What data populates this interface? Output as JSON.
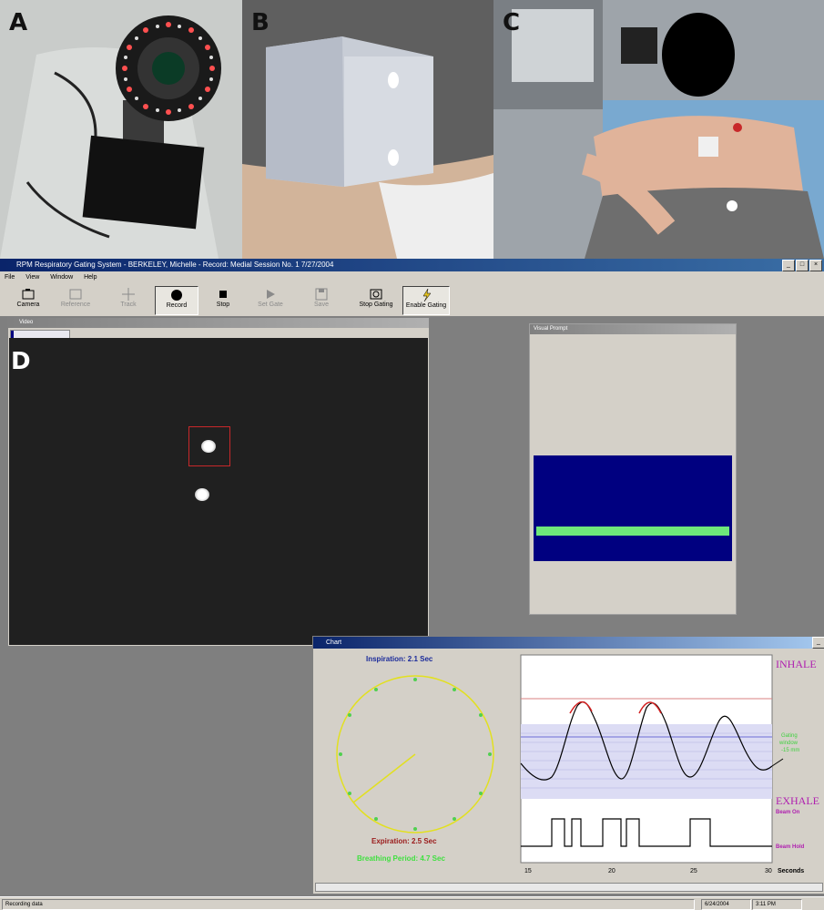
{
  "panels": {
    "a": "A",
    "b": "B",
    "c": "C",
    "d": "D"
  },
  "window": {
    "title": "RPM Respiratory Gating System  -  BERKELEY, Michelle  -  Record: Medial Session No. 1  7/27/2004"
  },
  "menu": [
    "File",
    "View",
    "Window",
    "Help"
  ],
  "toolbar": [
    {
      "label": "Camera",
      "icon": "camera-icon",
      "state": "normal"
    },
    {
      "label": "Reference",
      "icon": "reference-icon",
      "state": "disabled"
    },
    {
      "label": "Track",
      "icon": "crosshair-icon",
      "state": "disabled"
    },
    {
      "label": "Record",
      "icon": "record-icon",
      "state": "pressed"
    },
    {
      "label": "Stop",
      "icon": "stop-icon",
      "state": "normal"
    },
    {
      "label": "Set Gate",
      "icon": "play-icon",
      "state": "disabled"
    },
    {
      "label": "Save",
      "icon": "save-icon",
      "state": "disabled"
    },
    {
      "label": "Stop Gating",
      "icon": "stop-gating-icon",
      "state": "normal"
    },
    {
      "label": "Enable Gating",
      "icon": "enable-gating-icon",
      "state": "normal"
    }
  ],
  "video_window": {
    "title": "Video"
  },
  "visual_prompt": {
    "title": "Visual Prompt",
    "level": 0.74
  },
  "chart_window": {
    "title": "Chart"
  },
  "chart_data": {
    "type": "line",
    "dial": {
      "inspiration": "Inspiration: 2.1 Sec",
      "expiration": "Expiration: 2.5 Sec",
      "breathing_period": "Breathing Period: 4.7 Sec"
    },
    "labels": {
      "inhale": "INHALE",
      "exhale": "EXHALE",
      "gating_window": [
        "Gating",
        "window",
        "-15 mm"
      ],
      "beam_on": "Beam On",
      "beam_hold": "Beam Hold",
      "unit": "Seconds"
    },
    "x_ticks": [
      "15",
      "20",
      "25",
      "30"
    ],
    "colors": {
      "trace": "#000000",
      "peak": "#d22020",
      "window_band": "#6b6bd6",
      "gate": "#000000"
    }
  },
  "status": {
    "left": "Recording data",
    "date": "6/24/2004",
    "time": "3:11 PM"
  }
}
